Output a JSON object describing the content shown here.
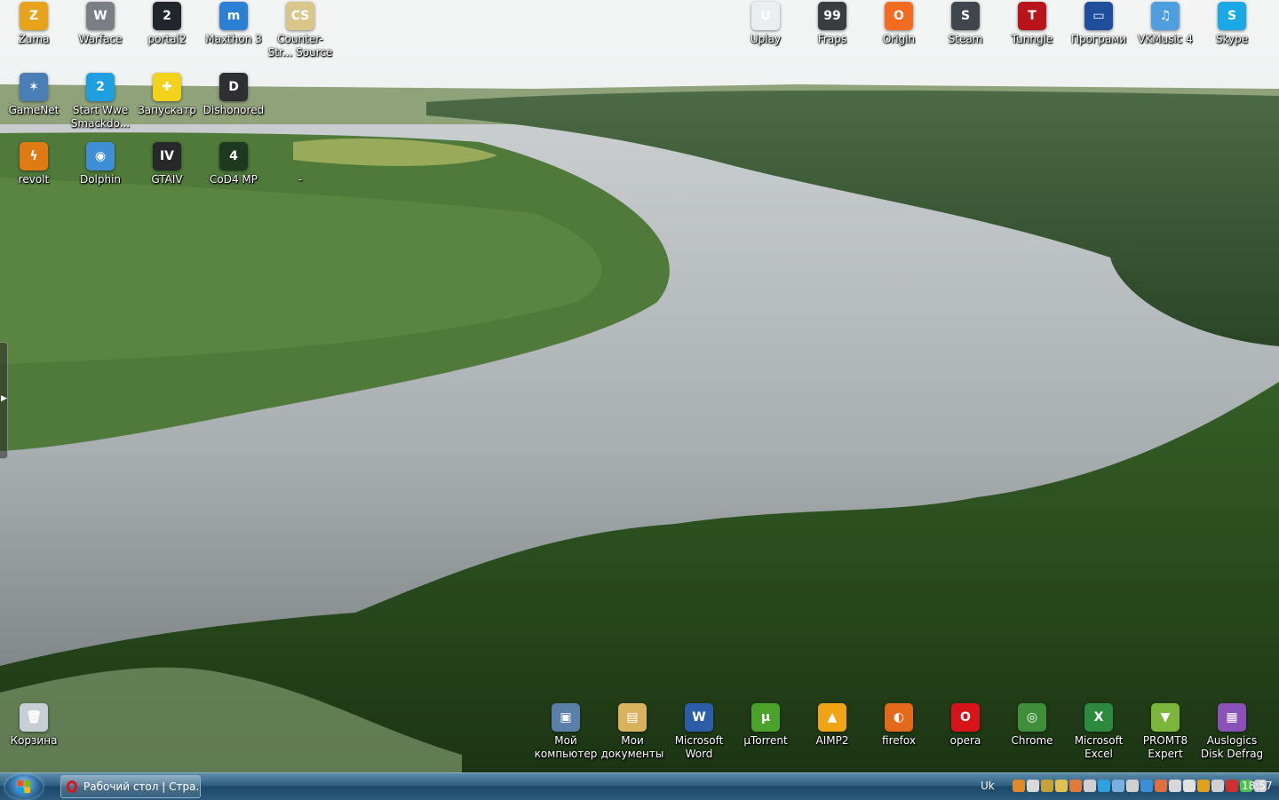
{
  "desktop": {
    "icons": [
      {
        "label": "Zuma",
        "icon": "zuma-icon",
        "color": "#e8a21c",
        "glyph": "Z"
      },
      {
        "label": "Warface",
        "icon": "warface-icon",
        "color": "#7a7f86",
        "glyph": "W"
      },
      {
        "label": "portal2",
        "icon": "portal2-icon",
        "color": "#20262c",
        "glyph": "2"
      },
      {
        "label": "Maxthon 3",
        "icon": "maxthon-icon",
        "color": "#2b7fd4",
        "glyph": "m"
      },
      {
        "label": "Counter-Str... Source",
        "icon": "counter-strike-icon",
        "color": "#d9c68a",
        "glyph": "CS"
      },
      {
        "label": "GameNet",
        "icon": "gamenet-icon",
        "color": "#4a7fb5",
        "glyph": "✶"
      },
      {
        "label": "Start Wwe Smackdo...",
        "icon": "smackdown-icon",
        "color": "#1d9fe2",
        "glyph": "2"
      },
      {
        "label": "Запускатр",
        "icon": "launcher-icon",
        "color": "#f2d21a",
        "glyph": "✚"
      },
      {
        "label": "Dishonored",
        "icon": "dishonored-icon",
        "color": "#2e2f30",
        "glyph": "D"
      },
      {
        "label": "revolt",
        "icon": "revolt-icon",
        "color": "#e07a12",
        "glyph": "ϟ"
      },
      {
        "label": "Dolphin",
        "icon": "dolphin-icon",
        "color": "#3f8fd8",
        "glyph": "◉"
      },
      {
        "label": "GTAIV",
        "icon": "gtaiv-icon",
        "color": "#26282a",
        "glyph": "IV"
      },
      {
        "label": "CoD4 MP",
        "icon": "cod4-icon",
        "color": "#1e3a1e",
        "glyph": "4"
      },
      {
        "label": "-",
        "icon": "blank-icon",
        "color": "transparent",
        "glyph": ""
      },
      {
        "label": "Uplay",
        "icon": "uplay-icon",
        "color": "#e9eef3",
        "glyph": "U"
      },
      {
        "label": "Fraps",
        "icon": "fraps-icon",
        "color": "#3a3d40",
        "glyph": "99"
      },
      {
        "label": "Origin",
        "icon": "origin-icon",
        "color": "#f36a21",
        "glyph": "O"
      },
      {
        "label": "Steam",
        "icon": "steam-icon",
        "color": "#40464d",
        "glyph": "S"
      },
      {
        "label": "Tunngle",
        "icon": "tunngle-icon",
        "color": "#b8141a",
        "glyph": "T"
      },
      {
        "label": "Програми",
        "icon": "programs-folder-icon",
        "color": "#1f4f9c",
        "glyph": "▭"
      },
      {
        "label": "VKMusic 4",
        "icon": "vkmusic-icon",
        "color": "#4f9fe0",
        "glyph": "♫"
      },
      {
        "label": "Skype",
        "icon": "skype-icon",
        "color": "#18a9e6",
        "glyph": "S"
      },
      {
        "label": "Корзина",
        "icon": "recycle-bin-icon",
        "color": "#c7cfd6",
        "glyph": "🗑"
      },
      {
        "label": "Мой компьютер",
        "icon": "my-computer-icon",
        "color": "#5a7fa8",
        "glyph": "▣"
      },
      {
        "label": "Мои документы",
        "icon": "my-documents-icon",
        "color": "#d9b25e",
        "glyph": "▤"
      },
      {
        "label": "Microsoft Word",
        "icon": "word-icon",
        "color": "#2c5da8",
        "glyph": "W"
      },
      {
        "label": "µTorrent",
        "icon": "utorrent-icon",
        "color": "#4aa22a",
        "glyph": "µ"
      },
      {
        "label": "AIMP2",
        "icon": "aimp-icon",
        "color": "#f0a414",
        "glyph": "▲"
      },
      {
        "label": "firefox",
        "icon": "firefox-icon",
        "color": "#e36a1a",
        "glyph": "◐"
      },
      {
        "label": "opera",
        "icon": "opera-icon",
        "color": "#d8141b",
        "glyph": "O"
      },
      {
        "label": "Chrome",
        "icon": "chrome-icon",
        "color": "#3f8e3a",
        "glyph": "◎"
      },
      {
        "label": "Microsoft Excel",
        "icon": "excel-icon",
        "color": "#2b8a3e",
        "glyph": "X"
      },
      {
        "label": "PROMT8 Expert",
        "icon": "promt-icon",
        "color": "#7bb63a",
        "glyph": "▼"
      },
      {
        "label": "Auslogics Disk Defrag",
        "icon": "defrag-icon",
        "color": "#8a52b8",
        "glyph": "▦"
      }
    ]
  },
  "taskbar": {
    "start_icon": "windows-start-icon",
    "task_label": "Рабочий стол | Стра...",
    "task_icon": "opera-icon",
    "language": "Uk",
    "clock": "18:57",
    "tray_colors": [
      "#e08a2a",
      "#d9d9d9",
      "#c9a13a",
      "#e0c050",
      "#e07a3a",
      "#d0d0d0",
      "#2fa0e0",
      "#7ab0e0",
      "#d0d0d0",
      "#3a8fd8",
      "#e07040",
      "#d8d8d8",
      "#e0e0e0",
      "#e0a020",
      "#d0d0d0",
      "#cc3030",
      "#4fbf4f",
      "#d0d0d0"
    ]
  }
}
